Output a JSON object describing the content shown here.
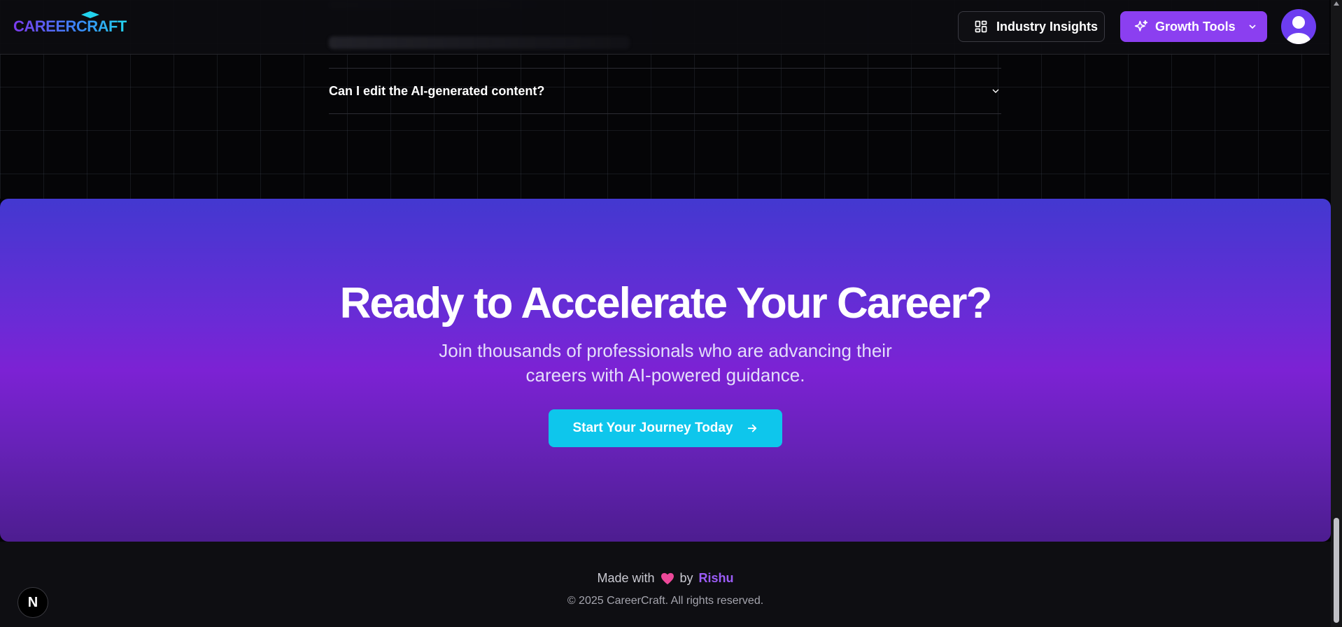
{
  "header": {
    "logo_text": "CAREERCRAFT",
    "insights_label": "Industry Insights",
    "growth_label": "Growth Tools"
  },
  "faq": {
    "items": [
      {
        "question": "Can I edit the AI-generated content?"
      }
    ]
  },
  "cta": {
    "title": "Ready to Accelerate Your Career?",
    "subtitle": "Join thousands of professionals who are advancing their careers with AI-powered guidance.",
    "button_label": "Start Your Journey Today"
  },
  "footer": {
    "made_with": "Made with",
    "by": "by",
    "author": "Rishu",
    "copyright": "© 2025 CareerCraft. All rights reserved."
  },
  "badge": {
    "letter": "N"
  },
  "colors": {
    "accent_purple": "#8b3ff0",
    "cta_button": "#0ec6ec",
    "author_link": "#9b5cf6",
    "heart": "#ec4899"
  },
  "icons": {
    "insights": "layout-dashboard-icon",
    "growth": "sparkles-icon",
    "chevron": "chevron-down-icon",
    "arrow": "arrow-right-icon",
    "heart": "heart-icon",
    "avatar": "user-avatar-icon"
  }
}
